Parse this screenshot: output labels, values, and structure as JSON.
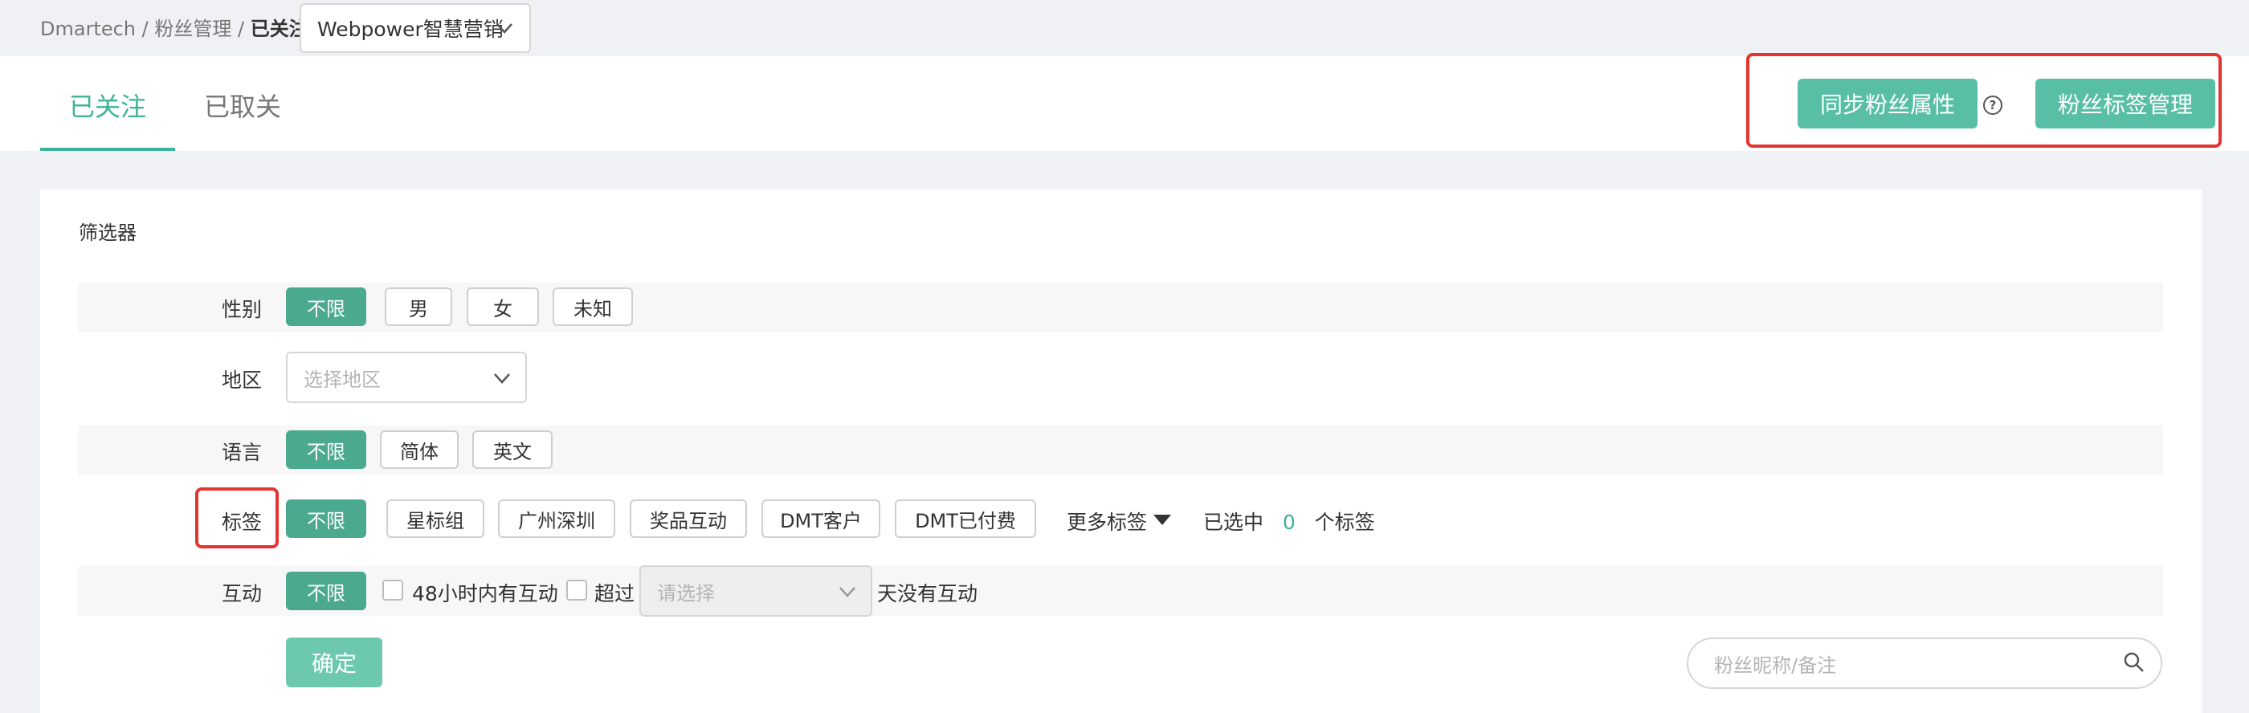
{
  "breadcrumb": {
    "item1": "Dmartech",
    "sep1": " / ",
    "item2": "粉丝管理",
    "sep2": " / ",
    "current": "已关注"
  },
  "account_select": {
    "value": "Webpower智慧营销",
    "icon": "chevron-down-icon"
  },
  "tabs": [
    {
      "label": "已关注",
      "active": true
    },
    {
      "label": "已取关",
      "active": false
    }
  ],
  "actions": {
    "sync_label": "同步粉丝属性",
    "help_glyph": "?",
    "tag_manage_label": "粉丝标签管理"
  },
  "filter": {
    "title": "筛选器",
    "gender": {
      "label": "性别",
      "options": [
        "不限",
        "男",
        "女",
        "未知"
      ],
      "selected": "不限"
    },
    "region": {
      "label": "地区",
      "placeholder": "选择地区"
    },
    "language": {
      "label": "语言",
      "options": [
        "不限",
        "简体",
        "英文"
      ],
      "selected": "不限"
    },
    "tags": {
      "label": "标签",
      "options": [
        "不限",
        "星标组",
        "广州深圳",
        "奖品互动",
        "DMT客户",
        "DMT已付费"
      ],
      "selected": "不限",
      "more_label": "更多标签",
      "selected_prefix": "已选中",
      "selected_count": "0",
      "selected_suffix": "个标签"
    },
    "interaction": {
      "label": "互动",
      "unlimited": "不限",
      "within48": "48小时内有互动",
      "over_label": "超过",
      "select_placeholder": "请选择",
      "suffix": "天没有互动"
    },
    "confirm_label": "确定"
  },
  "search": {
    "placeholder": "粉丝昵称/备注",
    "icon": "search-icon"
  },
  "colors": {
    "accent": "#3db399",
    "button": "#58bfa6",
    "chip_active": "#4aa98f",
    "highlight": "#e3342f"
  }
}
